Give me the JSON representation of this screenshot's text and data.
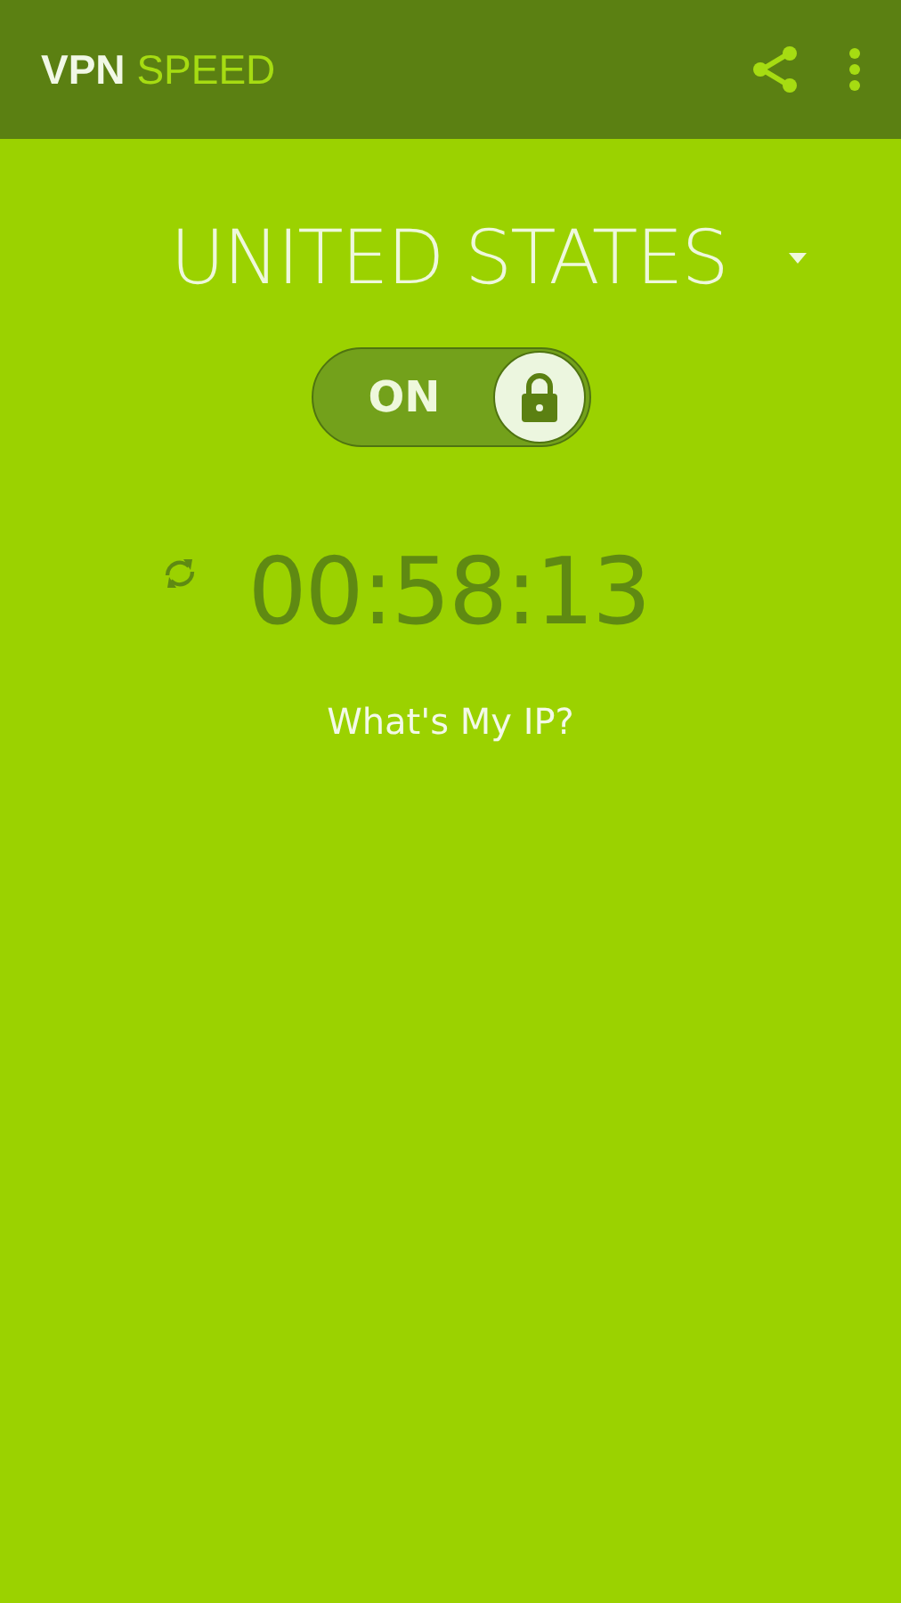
{
  "app_bar": {
    "title_primary": "VPN",
    "title_secondary": "SPEED"
  },
  "country": {
    "name": "UNITED STATES"
  },
  "vpn_switch": {
    "label": "ON",
    "on": true
  },
  "timer": {
    "elapsed": "00:58:13"
  },
  "ip_link": {
    "label": "What's My IP?"
  }
}
